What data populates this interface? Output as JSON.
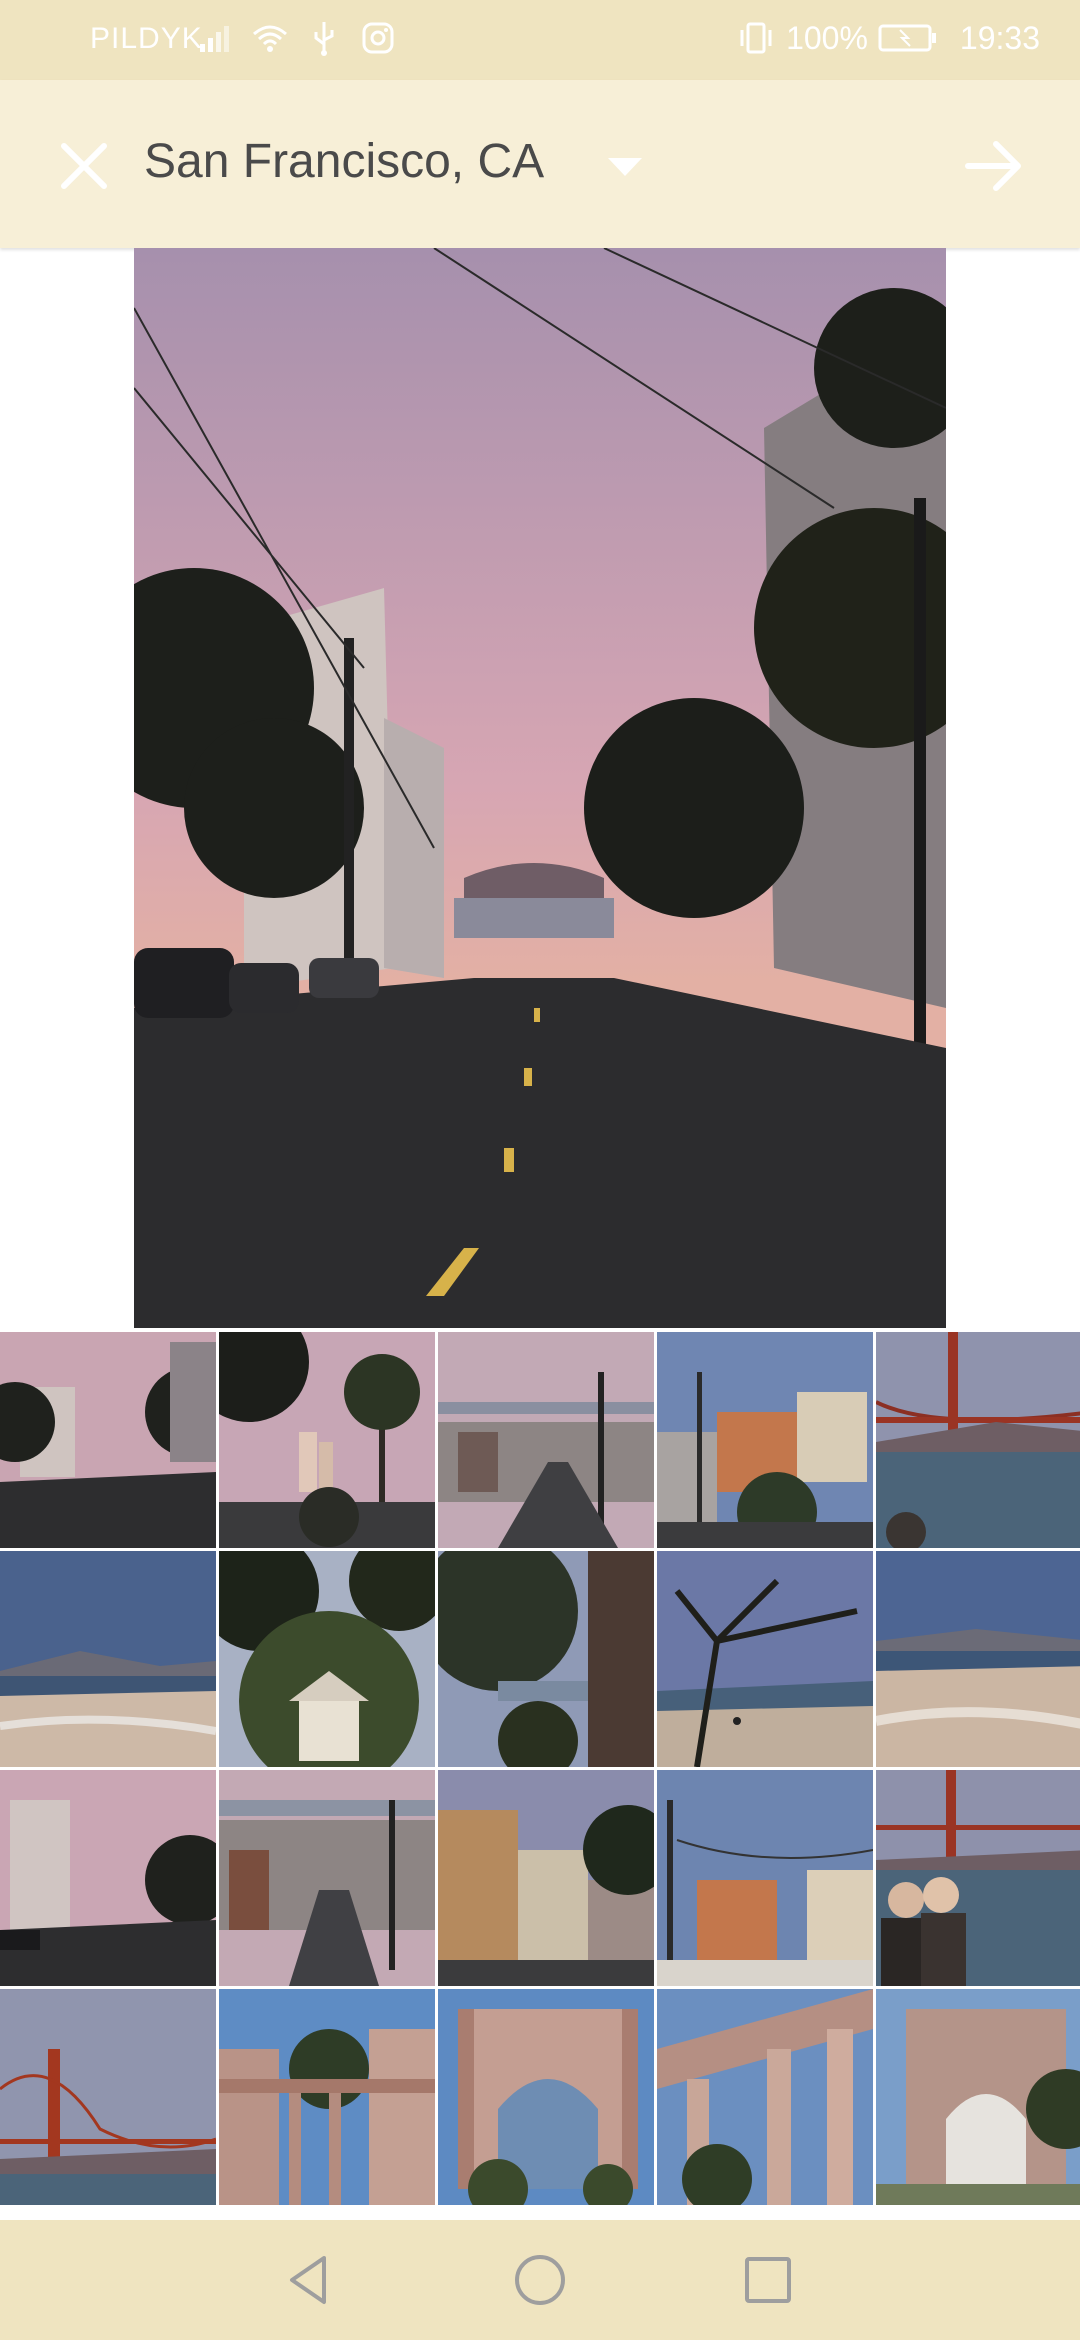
{
  "status_bar": {
    "carrier": "PILDYK",
    "battery": "100%",
    "time": "19:33"
  },
  "header": {
    "location": "San Francisco, CA",
    "icons": {
      "close": "close-icon",
      "dropdown": "dropdown-arrow-icon",
      "next": "arrow-right-icon"
    }
  },
  "colors": {
    "status_bar_bg": "#efe4c0",
    "header_bg": "#f7efd7",
    "title_text": "#4a4a4a",
    "nav_icon": "#9e9e9e"
  },
  "main_photo": {
    "description_icon": "street-sunset-photo"
  },
  "gallery": {
    "rows": [
      [
        "street-sunset",
        "palm-skyline",
        "hill-street",
        "victorian-houses",
        "golden-gate"
      ],
      [
        "beach-bay",
        "tree-house",
        "cypress-building",
        "tree-beach",
        "beach-kids"
      ],
      [
        "street-sunset-2",
        "hill-street-2",
        "painted-ladies",
        "victorian-houses-2",
        "golden-gate-portrait"
      ],
      [
        "golden-gate-2",
        "palace-colonnade",
        "palace-rotunda",
        "palace-columns",
        "palace-dome"
      ]
    ]
  },
  "nav_bar": {
    "icons": [
      "back-icon",
      "home-icon",
      "recents-icon"
    ]
  }
}
